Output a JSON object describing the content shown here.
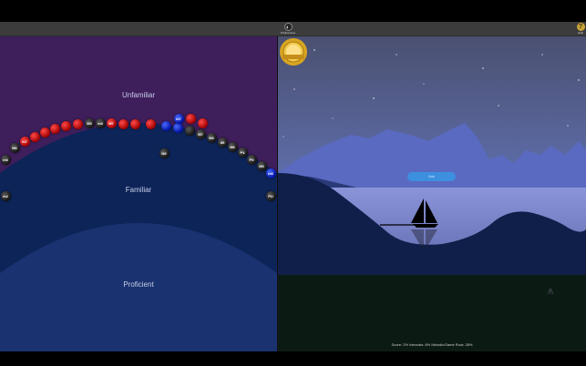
{
  "toolbar": {
    "preferences_label": "Preferences",
    "help_label": "Help",
    "help_glyph": "?"
  },
  "progress": {
    "zones": {
      "unfamiliar": "Unfamiliar",
      "familiar": "Familiar",
      "proficient": "Proficient"
    },
    "bubbles": [
      {
        "label": "m6",
        "color": "dark"
      },
      {
        "label": "M6",
        "color": "dark"
      },
      {
        "label": "m7",
        "color": "red"
      },
      {
        "label": "",
        "color": "red"
      },
      {
        "label": "",
        "color": "red"
      },
      {
        "label": "",
        "color": "red"
      },
      {
        "label": "",
        "color": "red"
      },
      {
        "label": "",
        "color": "red"
      },
      {
        "label": "M3",
        "color": "dark"
      },
      {
        "label": "m3",
        "color": "dark"
      },
      {
        "label": "M7",
        "color": "red"
      },
      {
        "label": "",
        "color": "red"
      },
      {
        "label": "",
        "color": "red"
      },
      {
        "label": "",
        "color": "red"
      },
      {
        "label": "",
        "color": "blue"
      },
      {
        "label": "",
        "color": "blue"
      },
      {
        "label": "",
        "color": "dark"
      },
      {
        "label": "M7",
        "color": "dark"
      },
      {
        "label": "M3",
        "color": "dark"
      },
      {
        "label": "d5",
        "color": "dark"
      },
      {
        "label": "M6",
        "color": "dark"
      },
      {
        "label": "P4",
        "color": "dark"
      },
      {
        "label": "P5",
        "color": "dark"
      },
      {
        "label": "M3",
        "color": "dark"
      },
      {
        "label": "m6",
        "color": "blue"
      },
      {
        "label": "m2",
        "color": "dark"
      },
      {
        "label": "M2",
        "color": "dark"
      },
      {
        "label": "PU",
        "color": "dark"
      },
      {
        "label": "m7",
        "color": "blue"
      },
      {
        "label": "",
        "color": "red"
      },
      {
        "label": "",
        "color": "red"
      }
    ]
  },
  "scene": {
    "badge_button": "Ask",
    "score_text": "Score: 2%   Intervals: 8%   Melodic/Same Root: 28%"
  },
  "colors": {
    "unfamiliar_bg": "#3f1e5c",
    "familiar_bg": "#0d2458",
    "proficient_bg": "#1a3270",
    "sky": "#5a6aa8",
    "water": "#7b86c8",
    "accent_button": "#3d8fe0"
  }
}
